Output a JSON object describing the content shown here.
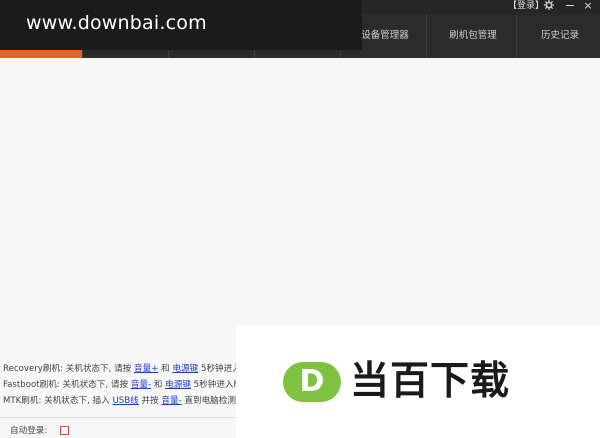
{
  "watermark_top": "www.downbai.com",
  "window": {
    "login_label": "【登录】",
    "close_glyph": "×"
  },
  "nav": [
    {
      "label": ""
    },
    {
      "label": ""
    },
    {
      "label": ""
    },
    {
      "label": ""
    },
    {
      "label": "设备管理器"
    },
    {
      "label": "刷机包管理"
    },
    {
      "label": "历史记录"
    }
  ],
  "instructions": [
    {
      "prefix": "Recovery刷机: 关机状态下, 请按 ",
      "link1": "音量+",
      "mid": " 和 ",
      "link2": "电源键",
      "suffix": " 5秒钟进入"
    },
    {
      "prefix": "Fastboot刷机: 关机状态下, 请按 ",
      "link1": "音量-",
      "mid": " 和 ",
      "link2": "电源键",
      "suffix": " 5秒钟进入F"
    },
    {
      "prefix": "MTK刷机: 关机状态下, 插入 ",
      "link1": "USB线",
      "mid": " 并按 ",
      "link2": "音量-",
      "suffix": " 直到电脑检测"
    }
  ],
  "footer": {
    "auto_login_label": "自动登录:"
  },
  "watermark_bottom": {
    "badge_letter": "D",
    "brand_text": "当百下载"
  },
  "colors": {
    "accent": "#e8641e",
    "topbar": "#2b2b2b",
    "link": "#1a3fc4",
    "logo_green": "#7fc241"
  },
  "icons": [
    "gear-icon",
    "minimize-icon",
    "close-icon",
    "checkbox"
  ]
}
